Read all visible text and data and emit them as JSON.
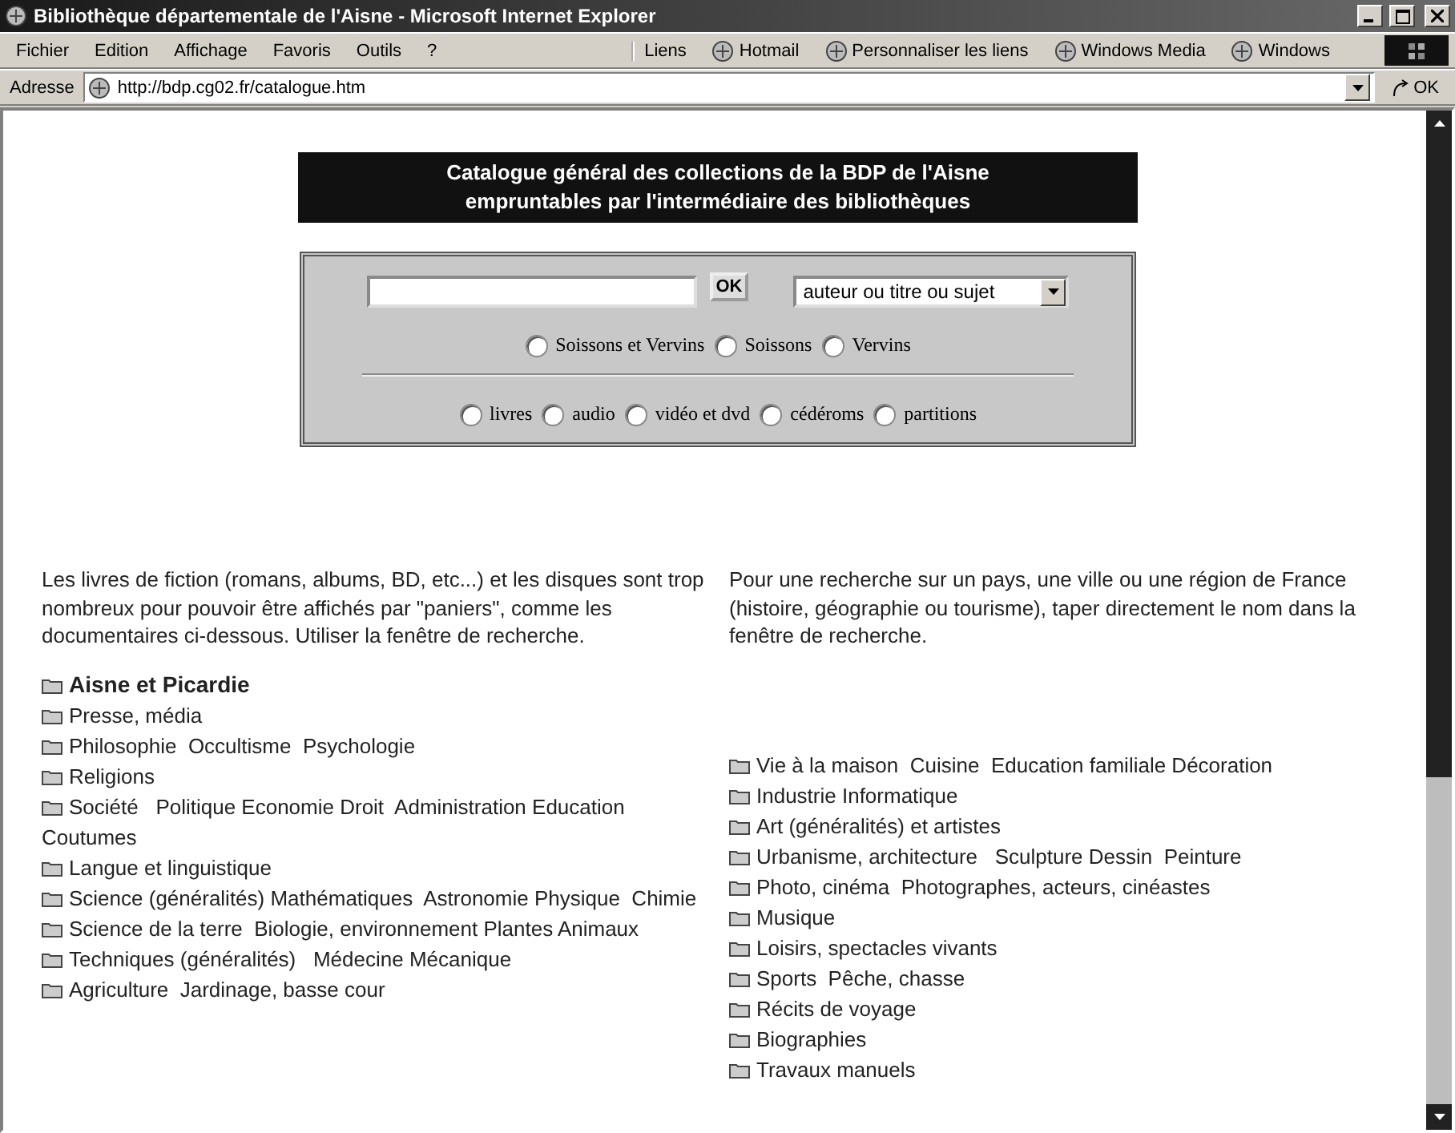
{
  "window": {
    "title": "Bibliothèque départementale de l'Aisne - Microsoft Internet Explorer"
  },
  "menu": [
    "Fichier",
    "Edition",
    "Affichage",
    "Favoris",
    "Outils",
    "?"
  ],
  "links_bar": {
    "label": "Liens",
    "links": [
      "Hotmail",
      "Personnaliser les liens",
      "Windows Media",
      "Windows"
    ]
  },
  "address_bar": {
    "label": "Adresse",
    "url": "http://bdp.cg02.fr/catalogue.htm",
    "go": "OK"
  },
  "banner": {
    "lines": [
      "Catalogue général des collections de la BDP de l'Aisne",
      "empruntables par l'intermédiaire des bibliothèques"
    ]
  },
  "search": {
    "button": "OK",
    "select": "auteur ou titre ou sujet",
    "locations": [
      {
        "label": "Soissons et Vervins",
        "selected": false
      },
      {
        "label": "Soissons",
        "selected": false
      },
      {
        "label": "Vervins",
        "selected": false
      }
    ],
    "media": [
      {
        "label": "livres",
        "selected": false
      },
      {
        "label": "audio",
        "selected": false
      },
      {
        "label": "vidéo et dvd",
        "selected": false
      },
      {
        "label": "cédéroms",
        "selected": false
      },
      {
        "label": "partitions",
        "selected": false
      }
    ]
  },
  "left_column": {
    "text": "Les livres de fiction (romans, albums, BD, etc...) et les disques sont trop nombreux pour pouvoir être affichés par \"paniers\", comme les documentaires ci-dessous. Utiliser la fenêtre de recherche.",
    "categories": [
      {
        "label": "Aisne et Picardie",
        "bold": true
      },
      {
        "label": "Presse, média",
        "bold": false
      },
      {
        "label": "Philosophie  Occultisme  Psychologie",
        "bold": false
      },
      {
        "label": "Religions",
        "bold": false
      },
      {
        "label": "Société   Politique Economie Droit  Administration Education  Coutumes",
        "bold": false
      },
      {
        "label": "Langue et linguistique",
        "bold": false
      },
      {
        "label": "Science (généralités) Mathématiques  Astronomie Physique  Chimie",
        "bold": false
      },
      {
        "label": "Science de la terre  Biologie, environnement Plantes Animaux",
        "bold": false
      },
      {
        "label": "Techniques (généralités)   Médecine Mécanique",
        "bold": false
      },
      {
        "label": "Agriculture  Jardinage, basse cour",
        "bold": false
      }
    ]
  },
  "right_column": {
    "text": "Pour une recherche sur un pays, une ville ou une région de France (histoire, géographie ou tourisme), taper directement le nom dans la fenêtre de recherche.",
    "categories": [
      {
        "label": "Vie à la maison  Cuisine  Education familiale Décoration",
        "bold": false
      },
      {
        "label": "Industrie Informatique",
        "bold": false
      },
      {
        "label": "Art (généralités) et artistes",
        "bold": false
      },
      {
        "label": "Urbanisme, architecture   Sculpture Dessin  Peinture",
        "bold": false
      },
      {
        "label": "Photo, cinéma  Photographes, acteurs, cinéastes",
        "bold": false
      },
      {
        "label": "Musique",
        "bold": false
      },
      {
        "label": "Loisirs, spectacles vivants",
        "bold": false
      },
      {
        "label": "Sports  Pêche, chasse",
        "bold": false
      },
      {
        "label": "Récits de voyage",
        "bold": false
      },
      {
        "label": "Biographies",
        "bold": false
      },
      {
        "label": "Travaux manuels",
        "bold": false
      }
    ]
  }
}
